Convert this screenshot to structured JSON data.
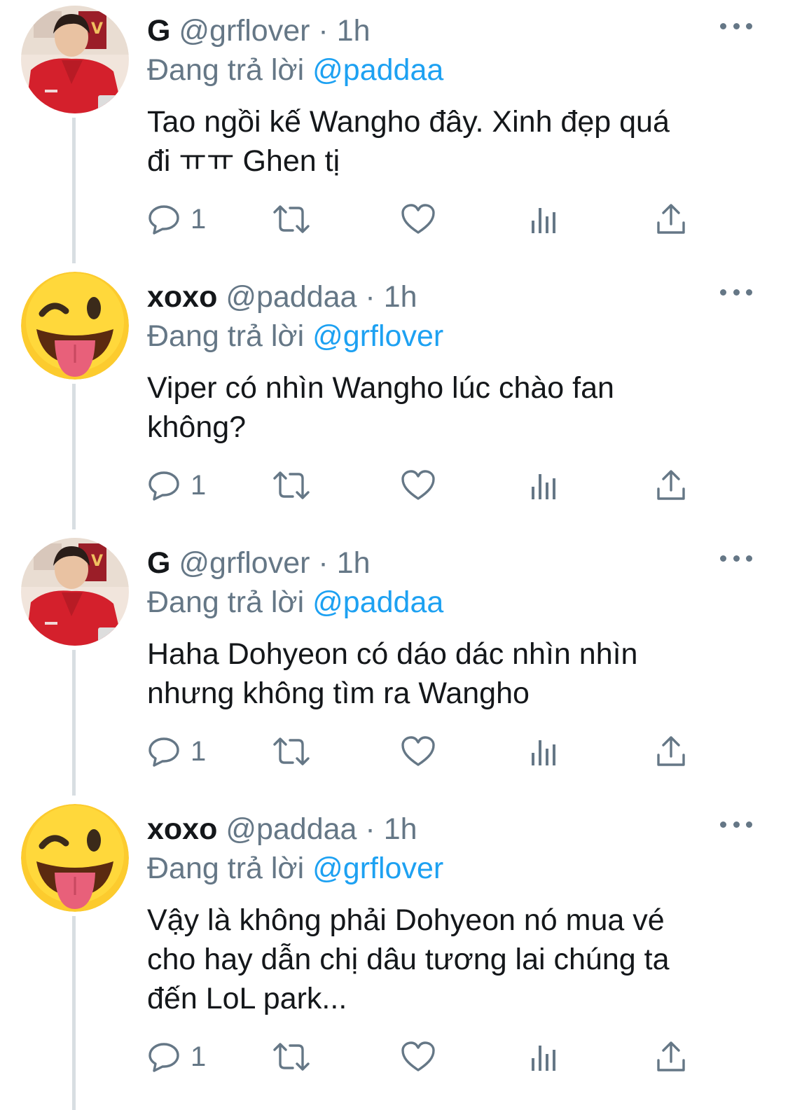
{
  "tweets": [
    {
      "display_name": "G",
      "handle": "@grflover",
      "separator": "·",
      "time": "1h",
      "reply_prefix": "Đang trả lời",
      "reply_to": "@paddaa",
      "text_lines": [
        "Tao ngồi kế Wangho đây. Xinh đẹp quá",
        "đi ㅠㅠ Ghen tị"
      ],
      "reply_count": "1",
      "avatar": "person-red-jacket"
    },
    {
      "display_name": "xoxo",
      "handle": "@paddaa",
      "separator": "·",
      "time": "1h",
      "reply_prefix": "Đang trả lời",
      "reply_to": "@grflover",
      "text_lines": [
        "Viper có nhìn Wangho lúc chào fan",
        "không?"
      ],
      "reply_count": "1",
      "avatar": "winking-face-tongue-emoji"
    },
    {
      "display_name": "G",
      "handle": "@grflover",
      "separator": "·",
      "time": "1h",
      "reply_prefix": "Đang trả lời",
      "reply_to": "@paddaa",
      "text_lines": [
        "Haha Dohyeon có dáo dác nhìn nhìn",
        "nhưng không tìm ra Wangho"
      ],
      "reply_count": "1",
      "avatar": "person-red-jacket"
    },
    {
      "display_name": "xoxo",
      "handle": "@paddaa",
      "separator": "·",
      "time": "1h",
      "reply_prefix": "Đang trả lời",
      "reply_to": "@grflover",
      "text_lines": [
        "Vậy là không phải Dohyeon nó mua vé",
        "cho hay dẫn chị dâu tương lai chúng ta",
        "đến LoL park..."
      ],
      "reply_count": "1",
      "avatar": "winking-face-tongue-emoji"
    }
  ],
  "colors": {
    "text": "#14171a",
    "secondary": "#657786",
    "link": "#1da1f2",
    "thread_line": "#d8dee2"
  },
  "icons": [
    "reply-icon",
    "retweet-icon",
    "like-icon",
    "analytics-icon",
    "share-icon",
    "more-icon"
  ]
}
